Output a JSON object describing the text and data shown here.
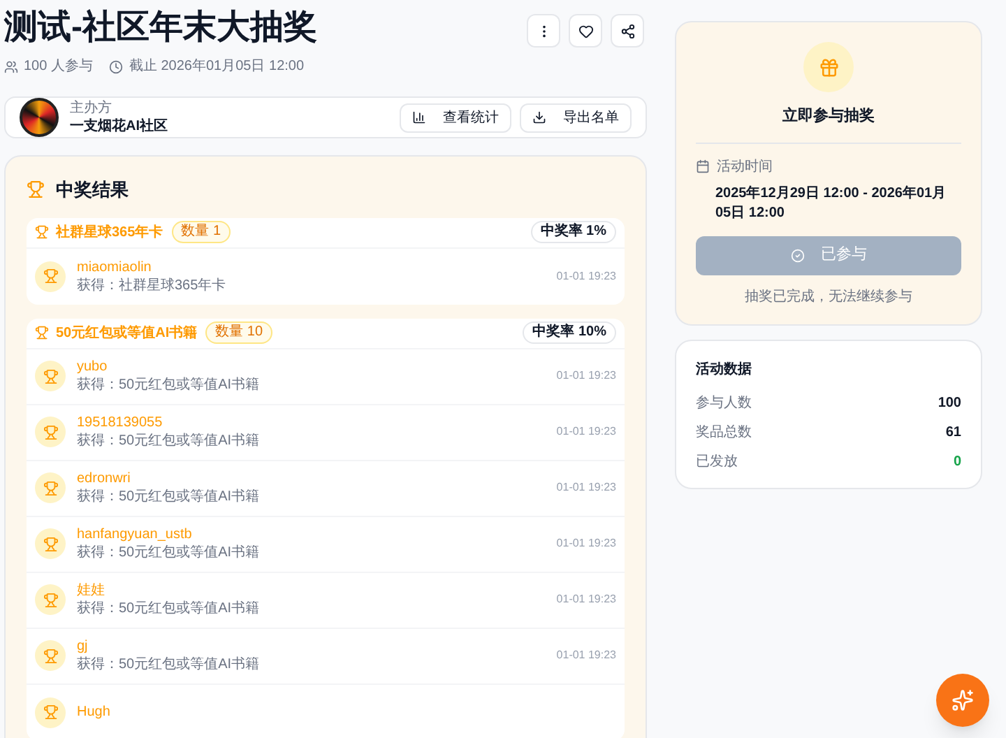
{
  "title": "测试-社区年末大抽奖",
  "meta": {
    "participants": "100 人参与",
    "deadline": "截止 2026年01月05日 12:00"
  },
  "organizer": {
    "label": "主办方",
    "name": "一支烟花AI社区",
    "buttons": [
      "查看统计",
      "导出名单"
    ]
  },
  "results": {
    "title": "中奖结果",
    "groups": [
      {
        "name": "社群星球365年卡",
        "count": "数量 1",
        "rate": "中奖率 1%",
        "winners": [
          {
            "name": "miaomiaolin",
            "prize": "获得：社群星球365年卡",
            "time": "01-01 19:23"
          }
        ]
      },
      {
        "name": "50元红包或等值AI书籍",
        "count": "数量 10",
        "rate": "中奖率 10%",
        "winners": [
          {
            "name": "yubo",
            "prize": "获得：50元红包或等值AI书籍",
            "time": "01-01 19:23"
          },
          {
            "name": "19518139055",
            "prize": "获得：50元红包或等值AI书籍",
            "time": "01-01 19:23"
          },
          {
            "name": "edronwri",
            "prize": "获得：50元红包或等值AI书籍",
            "time": "01-01 19:23"
          },
          {
            "name": "hanfangyuan_ustb",
            "prize": "获得：50元红包或等值AI书籍",
            "time": "01-01 19:23"
          },
          {
            "name": "娃娃",
            "prize": "获得：50元红包或等值AI书籍",
            "time": "01-01 19:23"
          },
          {
            "name": "gj",
            "prize": "获得：50元红包或等值AI书籍",
            "time": "01-01 19:23"
          },
          {
            "name": "Hugh"
          }
        ]
      }
    ]
  },
  "join": {
    "title": "立即参与抽奖",
    "time_label": "活动时间",
    "time": "2025年12月29日 12:00 - 2026年01月05日 12:00",
    "button": {
      "label": "已参与",
      "disabled": true
    },
    "note": "抽奖已完成，无法继续参与"
  },
  "stats": {
    "title": "活动数据",
    "items": [
      {
        "label": "参与人数",
        "value": "100",
        "color": "#111827"
      },
      {
        "label": "奖品总数",
        "value": "61",
        "color": "#111827"
      },
      {
        "label": "已发放",
        "value": "0",
        "color": "#16a34a"
      }
    ]
  }
}
